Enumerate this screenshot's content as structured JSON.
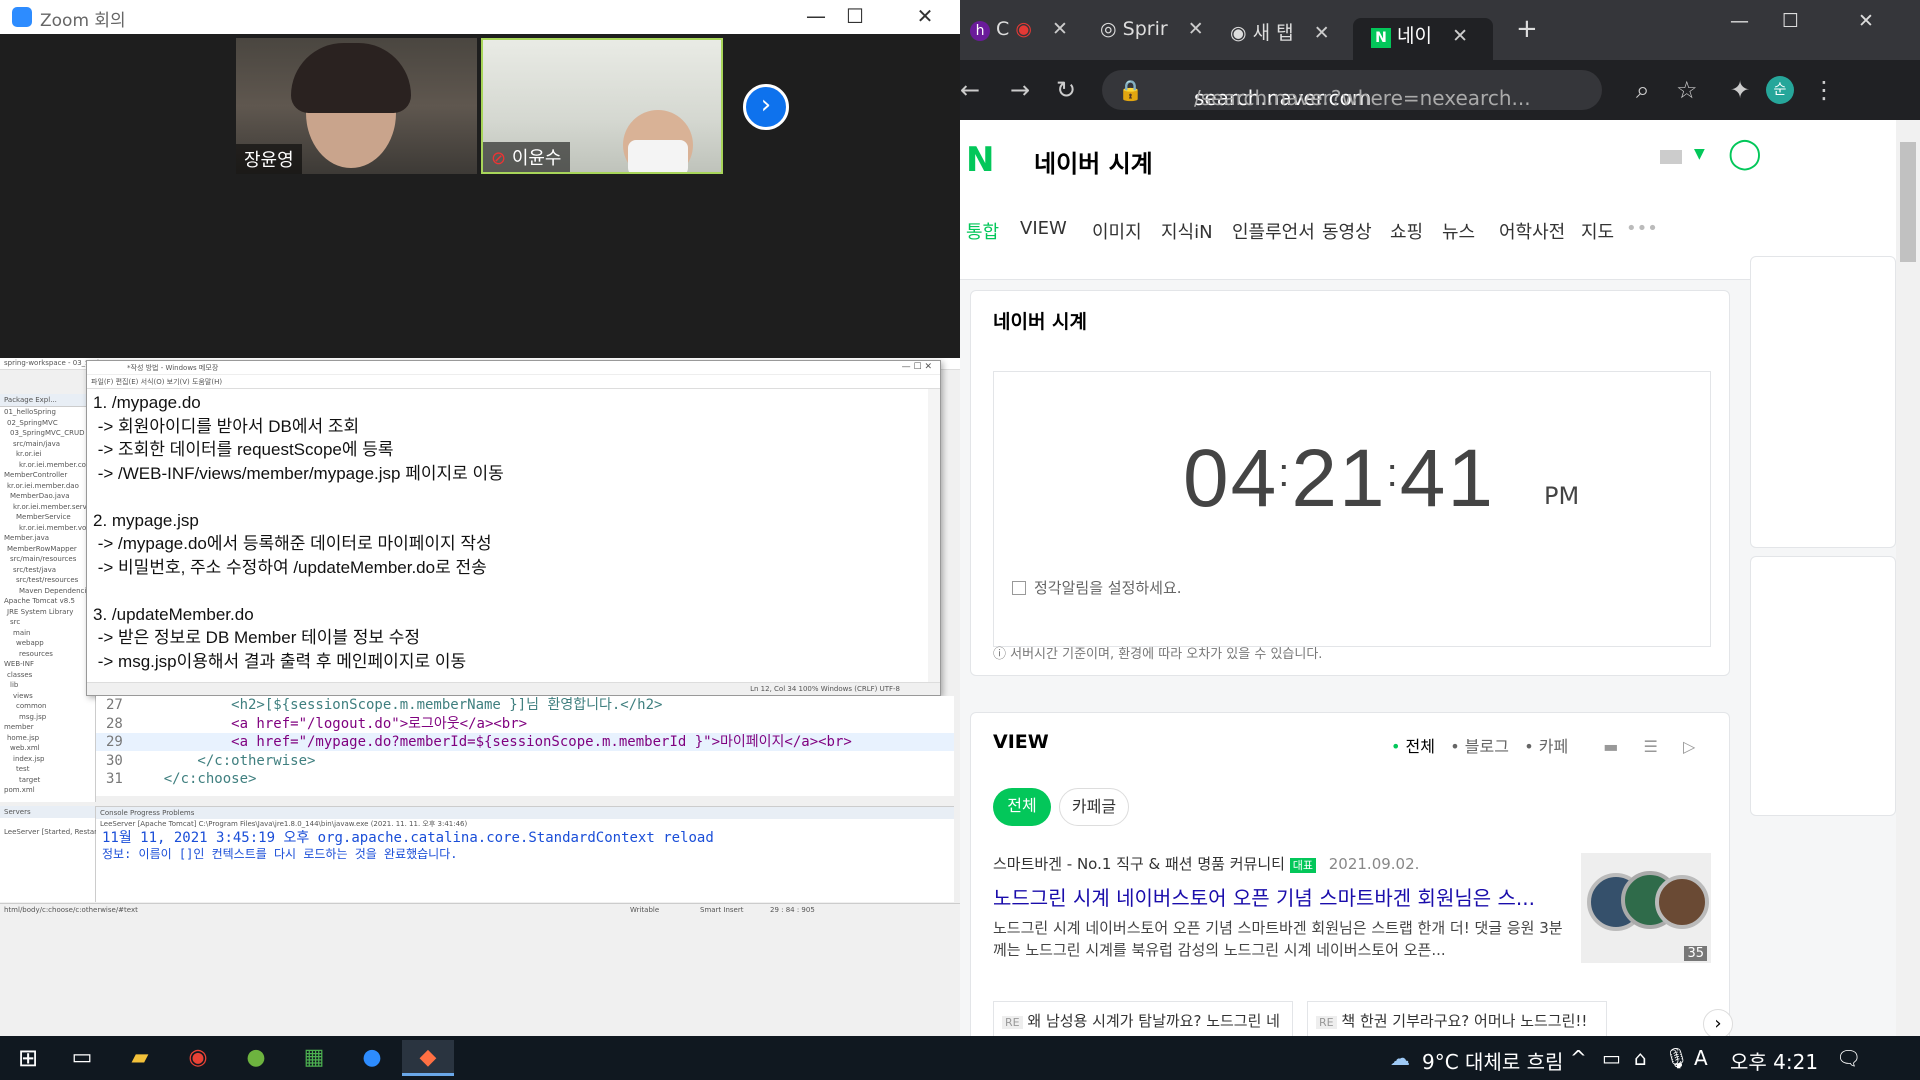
{
  "zoom": {
    "window_title": "Zoom 회의",
    "participants": [
      {
        "name": "장윤영"
      },
      {
        "name": "이윤수"
      }
    ]
  },
  "notepad": {
    "title": "*작성 방법 - Windows 메모장",
    "menu": "파일(F)  편집(E)  서식(O)  보기(V)  도움말(H)",
    "text": "1. /mypage.do\n -> 회원아이디를 받아서 DB에서 조회\n -> 조회한 데이터를 requestScope에 등록\n -> /WEB-INF/views/member/mypage.jsp 페이지로 이동\n\n2. mypage.jsp\n -> /mypage.do에서 등록해준 데이터로 마이페이지 작성\n -> 비밀번호, 주소 수정하여 /updateMember.do로 전송\n\n3. /updateMember.do\n -> 받은 정보로 DB Member 테이블 정보 수정\n -> msg.jsp이용해서 결과 출력 후 메인페이지로 이동",
    "status": "Ln 12, Col 34       100%     Windows (CRLF)      UTF-8"
  },
  "eclipse": {
    "title": "spring-workspace - 03_SpringMVC_CRUD",
    "package_explorer": "Package Expl...",
    "tree": [
      "01_helloSpring",
      "02_SpringMVC",
      "03_SpringMVC_CRUD",
      "src/main/java",
      "kr.or.iei",
      "kr.or.iei.member.controller",
      "MemberController",
      "kr.or.iei.member.dao",
      "MemberDao.java",
      "kr.or.iei.member.service",
      "MemberService",
      "kr.or.iei.member.vo",
      "Member.java",
      "MemberRowMapper",
      "src/main/resources",
      "src/test/java",
      "src/test/resources",
      "Maven Dependencies",
      "Apache Tomcat v8.5",
      "JRE System Library",
      "src",
      "main",
      "webapp",
      "resources",
      "WEB-INF",
      "classes",
      "lib",
      "views",
      "common",
      "msg.jsp",
      "member",
      "home.jsp",
      "web.xml",
      "index.jsp",
      "test",
      "target",
      "pom.xml"
    ],
    "code_lines": [
      {
        "num": "27",
        "text": "            <h2>[${sessionScope.m.memberName }]님 환영합니다.</h2>"
      },
      {
        "num": "28",
        "text": "            <a href=\"/logout.do\">로그아웃</a><br>"
      },
      {
        "num": "29",
        "text": "            <a href=\"/mypage.do?memberId=${sessionScope.m.memberId }\">마이페이지</a><br>"
      },
      {
        "num": "30",
        "text": "        </c:otherwise>"
      },
      {
        "num": "31",
        "text": "    </c:choose>"
      }
    ],
    "console_tabs": "Console  Progress  Problems",
    "console_header": "LeeServer [Apache Tomcat] C:\\Program Files\\Java\\jre1.8.0_144\\bin\\javaw.exe (2021. 11. 11. 오후 3:41:46)",
    "console_line1": "11월 11, 2021 3:45:19 오후 org.apache.catalina.core.StandardContext reload",
    "console_line2": "정보: 이름이 []인 컨텍스트를 다시 로드하는 것을 완료했습니다.",
    "servers_label": "Servers",
    "server_item": "LeeServer [Started, Restart]",
    "status_path": "html/body/c:choose/c:otherwise/#text",
    "status_writable": "Writable",
    "status_insert": "Smart Insert",
    "status_pos": "29 : 84 : 905"
  },
  "chrome": {
    "tabs": [
      {
        "label": "C"
      },
      {
        "label": "Sprir"
      },
      {
        "label": "새 탭"
      },
      {
        "label": "네이"
      }
    ],
    "url_host": "search.naver.com",
    "url_rest": "/search.naver?where=nexearch...",
    "profile_initial": "순"
  },
  "naver": {
    "query": "네이버 시계",
    "tabs": [
      "통합",
      "VIEW",
      "이미지",
      "지식iN",
      "인플루언서",
      "동영상",
      "쇼핑",
      "뉴스",
      "어학사전",
      "지도"
    ],
    "clock": {
      "title": "네이버 시계",
      "hours": "04",
      "minutes": "21",
      "seconds": "41",
      "ampm": "PM",
      "alarm_label": "정각알림을 설정하세요.",
      "note": "서버시간 기준이며, 환경에 따라 오차가 있을 수 있습니다."
    },
    "view": {
      "title": "VIEW",
      "filters": [
        "전체",
        "블로그",
        "카페"
      ],
      "chips": [
        "전체",
        "카페글"
      ],
      "post_source": "스마트바겐 - No.1 직구 & 패션 명품 커뮤니티",
      "post_badge": "대표",
      "post_date": "2021.09.02.",
      "post_title": "노드그린 시계 네이버스토어 오픈 기념 스마트바겐 회원님은 스...",
      "post_desc": "노드그린 시계 네이버스토어 오픈 기념 스마트바겐 회원님은 스트랩 한개 더! 댓글 응원 3분께는 노드그린 시계를 북유럽 감성의 노드그린 시계 네이버스토어 오픈...",
      "thumb_count": "35",
      "sub1": "왜 남성용 시계가 탐날까요? 노드그린 네이버스토어 오픈 축하 축하 드립니다. 구경 ...",
      "sub2": "책 한권 기부라구요? 어머나 노드그린!! 착한 기업은 응원함이 당연한거죠 구경갑니...",
      "sub_badge": "RE"
    }
  },
  "taskbar": {
    "weather": "9°C 대체로 흐림",
    "ime": "A",
    "time": "오후 4:21"
  },
  "colors": {
    "naver_green": "#03c75a",
    "zoom_blue": "#0e72ed",
    "link_blue": "#1a0dab"
  }
}
